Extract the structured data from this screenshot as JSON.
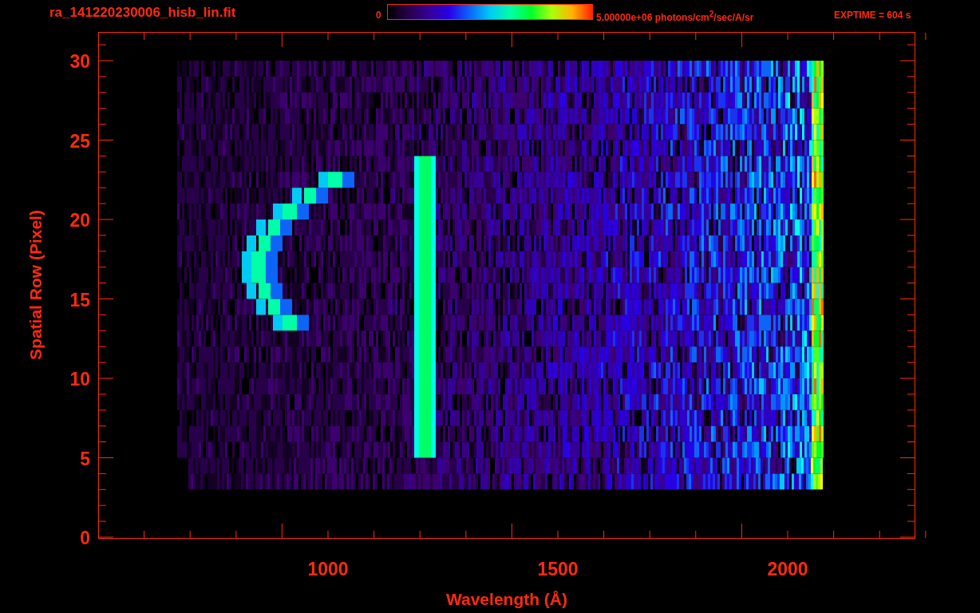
{
  "title": "ra_141220230006_hisb_lin.fit",
  "colorbar": {
    "min_label": "0",
    "max_label": "5.00000e+06 photons/cm$^{2}$/sec/A/sr"
  },
  "exposure": "EXPTIME = 604 s",
  "x_axis": {
    "label": "Wavelength (Å)",
    "ticks": [
      "1000",
      "1500",
      "2000"
    ]
  },
  "y_axis": {
    "label": "Spatial Row (Pixel)",
    "ticks": [
      "30",
      "25",
      "20",
      "15",
      "10",
      "5",
      "0"
    ]
  }
}
